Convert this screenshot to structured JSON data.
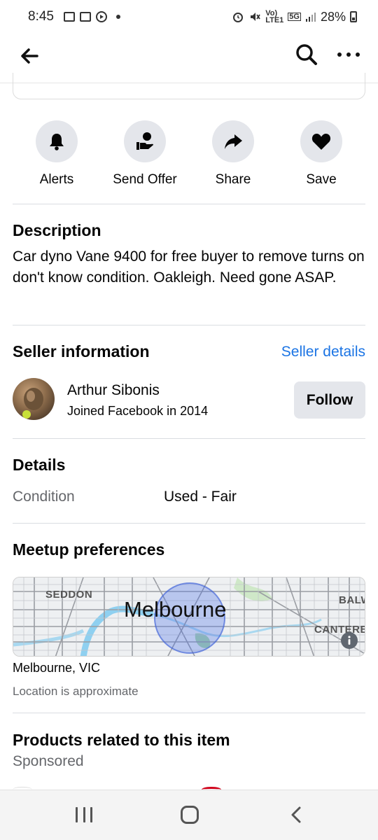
{
  "status_bar": {
    "time": "8:45",
    "network": "5G",
    "volte_top": "Vo)",
    "volte_bottom": "LTE1",
    "battery": "28%"
  },
  "app_bar": {
    "icons": [
      "back-arrow-icon",
      "search-icon",
      "more-icon"
    ]
  },
  "actions": [
    {
      "label": "Alerts",
      "icon": "bell-icon"
    },
    {
      "label": "Send Offer",
      "icon": "offer-icon"
    },
    {
      "label": "Share",
      "icon": "share-icon"
    },
    {
      "label": "Save",
      "icon": "heart-icon"
    }
  ],
  "description": {
    "title": "Description",
    "text": "Car dyno Vane 9400 for free buyer to remove turns on don't know condition. Oakleigh. Need gone ASAP."
  },
  "seller": {
    "title": "Seller information",
    "details_link": "Seller details",
    "name": "Arthur Sibonis",
    "joined": "Joined Facebook in 2014",
    "follow_label": "Follow"
  },
  "details": {
    "title": "Details",
    "rows": [
      {
        "key": "Condition",
        "value": "Used - Fair"
      }
    ]
  },
  "meetup": {
    "title": "Meetup preferences",
    "map_labels": {
      "seddon": "SEDDON",
      "city": "Melbourne",
      "balwyn": "BALW",
      "canterbury": "CANTERB"
    },
    "location": "Melbourne, VIC",
    "approx_note": "Location is approximate"
  },
  "related": {
    "title": "Products related to this item",
    "sponsored": "Sponsored"
  },
  "colors": {
    "accent": "#1b74e4",
    "button_bg": "#e4e6eb",
    "divider": "#dadde1",
    "secondary_text": "#65676b"
  }
}
